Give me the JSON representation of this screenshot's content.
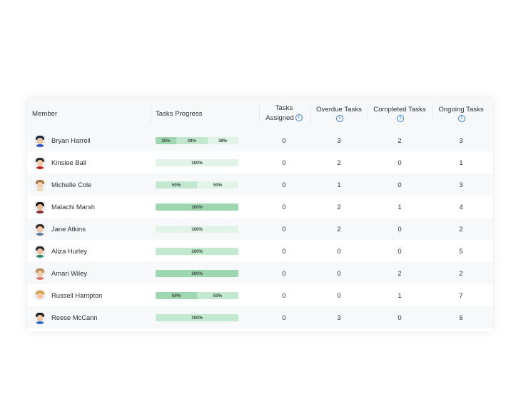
{
  "table": {
    "headers": {
      "member": "Member",
      "progress": "Tasks Progress",
      "assigned_line1": "Tasks",
      "assigned_line2": "Assigned",
      "overdue": "Overdue Tasks",
      "completed": "Completed Tasks",
      "ongoing": "Ongoing Tasks"
    },
    "info_icon": "info-icon",
    "colors": {
      "seg_dark": "#9ed6b2",
      "seg_mid": "#c2e8cf",
      "seg_light": "#e1f4e7",
      "info": "#2f7fe0"
    },
    "rows": [
      {
        "name": "Bryan Harrell",
        "assigned": "0",
        "overdue": "3",
        "completed": "2",
        "ongoing": "3",
        "progress": [
          {
            "label": "25%",
            "pct": 25,
            "shade": "dark"
          },
          {
            "label": "38%",
            "pct": 37.5,
            "shade": "mid"
          },
          {
            "label": "38%",
            "pct": 37.5,
            "shade": "light"
          }
        ],
        "avatar": {
          "hair": "#1d2a44",
          "skin": "#f0c4a0",
          "shirt": "#3050c8"
        }
      },
      {
        "name": "Kinslee Ball",
        "assigned": "0",
        "overdue": "2",
        "completed": "0",
        "ongoing": "1",
        "progress": [
          {
            "label": "100%",
            "pct": 100,
            "shade": "light"
          }
        ],
        "avatar": {
          "hair": "#2a2a2a",
          "skin": "#f3caa8",
          "shirt": "#c22a2a"
        }
      },
      {
        "name": "Michelle Cole",
        "assigned": "0",
        "overdue": "1",
        "completed": "0",
        "ongoing": "3",
        "progress": [
          {
            "label": "50%",
            "pct": 50,
            "shade": "mid"
          },
          {
            "label": "50%",
            "pct": 50,
            "shade": "light"
          }
        ],
        "avatar": {
          "hair": "#a7713a",
          "skin": "#f3cfb0",
          "shirt": "#e8d9b0"
        }
      },
      {
        "name": "Malachi Marsh",
        "assigned": "0",
        "overdue": "2",
        "completed": "1",
        "ongoing": "4",
        "progress": [
          {
            "label": "100%",
            "pct": 100,
            "shade": "dark"
          }
        ],
        "avatar": {
          "hair": "#1b1b1b",
          "skin": "#e9bc98",
          "shirt": "#8a2a3a"
        }
      },
      {
        "name": "Jane Atkins",
        "assigned": "0",
        "overdue": "2",
        "completed": "0",
        "ongoing": "2",
        "progress": [
          {
            "label": "100%",
            "pct": 100,
            "shade": "light"
          }
        ],
        "avatar": {
          "hair": "#3a2a20",
          "skin": "#f0c8a6",
          "shirt": "#5a7aa0"
        }
      },
      {
        "name": "Aliza Hurley",
        "assigned": "0",
        "overdue": "0",
        "completed": "0",
        "ongoing": "5",
        "progress": [
          {
            "label": "100%",
            "pct": 100,
            "shade": "mid"
          }
        ],
        "avatar": {
          "hair": "#2a2a2a",
          "skin": "#eec29e",
          "shirt": "#2a8a7a"
        }
      },
      {
        "name": "Amari Wiley",
        "assigned": "0",
        "overdue": "0",
        "completed": "2",
        "ongoing": "2",
        "progress": [
          {
            "label": "100%",
            "pct": 100,
            "shade": "dark"
          }
        ],
        "avatar": {
          "hair": "#b8864a",
          "skin": "#f2cba9",
          "shirt": "#e07a6a"
        }
      },
      {
        "name": "Russell Hampton",
        "assigned": "0",
        "overdue": "0",
        "completed": "1",
        "ongoing": "7",
        "progress": [
          {
            "label": "50%",
            "pct": 50,
            "shade": "dark"
          },
          {
            "label": "50%",
            "pct": 50,
            "shade": "mid"
          }
        ],
        "avatar": {
          "hair": "#d4a040",
          "skin": "#f2c8a4",
          "shirt": "#ffffff"
        }
      },
      {
        "name": "Reese McCann",
        "assigned": "0",
        "overdue": "3",
        "completed": "0",
        "ongoing": "6",
        "progress": [
          {
            "label": "100%",
            "pct": 100,
            "shade": "mid"
          }
        ],
        "avatar": {
          "hair": "#1e1e1e",
          "skin": "#f0c6a2",
          "shirt": "#2a6ad0"
        }
      }
    ]
  }
}
